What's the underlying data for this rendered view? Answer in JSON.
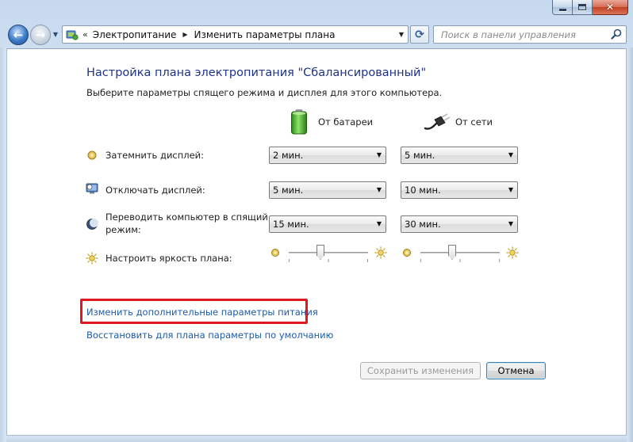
{
  "window": {
    "caption_buttons": {
      "minimize": "minimize-icon",
      "maximize": "maximize-icon",
      "close": "close-icon"
    }
  },
  "navigation": {
    "back_icon": "back-arrow-icon",
    "forward_icon": "forward-arrow-icon",
    "breadcrumb_prefix": "«",
    "breadcrumbs": [
      "Электропитание",
      "Изменить параметры плана"
    ],
    "search_placeholder": "Поиск в панели управления"
  },
  "page": {
    "title": "Настройка плана электропитания \"Сбалансированный\"",
    "subtitle": "Выберите параметры спящего режима и дисплея для этого компьютера.",
    "columns": {
      "battery": "От батареи",
      "ac": "От сети"
    }
  },
  "settings": [
    {
      "label": "Затемнить дисплей:",
      "battery": "2 мин.",
      "ac": "5 мин."
    },
    {
      "label": "Отключать дисплей:",
      "battery": "5 мин.",
      "ac": "10 мин."
    },
    {
      "label_line1": "Переводить компьютер в спящий",
      "label_line2": "режим:",
      "battery": "15 мин.",
      "ac": "30 мин."
    }
  ],
  "brightness": {
    "label": "Настроить яркость плана:",
    "battery_level": 0.4,
    "ac_level": 0.4
  },
  "links": {
    "advanced": "Изменить дополнительные параметры питания",
    "restore": "Восстановить для плана параметры по умолчанию"
  },
  "buttons": {
    "save": "Сохранить изменения",
    "cancel": "Отмена"
  },
  "colors": {
    "title": "#1e3287",
    "link": "#1d5aa8",
    "highlight_border": "#e0191f"
  }
}
